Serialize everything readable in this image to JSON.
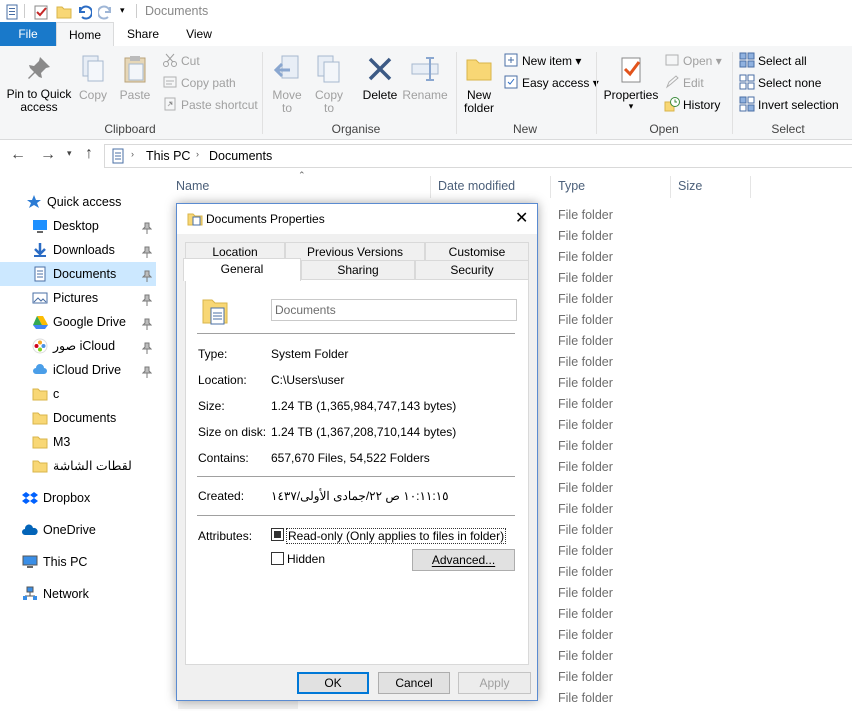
{
  "window": {
    "title": "Documents"
  },
  "qat": {
    "icons": [
      "properties-icon",
      "checkmark-icon",
      "new-folder-icon",
      "undo-icon",
      "redo-icon",
      "customize-chevron-icon"
    ]
  },
  "ribbon_tabs": [
    {
      "label": "File"
    },
    {
      "label": "Home"
    },
    {
      "label": "Share"
    },
    {
      "label": "View"
    }
  ],
  "ribbon": {
    "clipboard": {
      "pin": "Pin to Quick\naccess",
      "copy": "Copy",
      "paste": "Paste",
      "cut": "Cut",
      "copy_path": "Copy path",
      "paste_shortcut": "Paste shortcut",
      "label": "Clipboard"
    },
    "organise": {
      "move_to": "Move\nto",
      "copy_to": "Copy\nto",
      "delete": "Delete",
      "rename": "Rename",
      "label": "Organise"
    },
    "new": {
      "new_folder": "New\nfolder",
      "new_item": "New item",
      "easy_access": "Easy access",
      "label": "New"
    },
    "open": {
      "properties": "Properties",
      "open": "Open",
      "edit": "Edit",
      "history": "History",
      "label": "Open"
    },
    "select": {
      "select_all": "Select all",
      "select_none": "Select none",
      "invert": "Invert selection",
      "label": "Select"
    }
  },
  "address": {
    "crumbs": [
      "This PC",
      "Documents"
    ]
  },
  "sidebar": [
    {
      "label": "Quick access",
      "icon": "star-icon",
      "pinned": false
    },
    {
      "label": "Desktop",
      "icon": "desktop-icon",
      "pinned": true
    },
    {
      "label": "Downloads",
      "icon": "download-icon",
      "pinned": true
    },
    {
      "label": "Documents",
      "icon": "documents-icon",
      "pinned": true,
      "selected": true
    },
    {
      "label": "Pictures",
      "icon": "pictures-icon",
      "pinned": true
    },
    {
      "label": "Google Drive",
      "icon": "google-drive-icon",
      "pinned": true
    },
    {
      "label": "صور iCloud",
      "icon": "icloud-photos-icon",
      "pinned": true
    },
    {
      "label": "iCloud Drive",
      "icon": "icloud-drive-icon",
      "pinned": true
    },
    {
      "label": "c",
      "icon": "folder-icon",
      "pinned": false
    },
    {
      "label": "Documents",
      "icon": "folder-icon",
      "pinned": false
    },
    {
      "label": "M3",
      "icon": "folder-icon",
      "pinned": false
    },
    {
      "label": "لقطات الشاشة",
      "icon": "folder-icon",
      "pinned": false
    },
    {
      "label": "Dropbox",
      "icon": "dropbox-icon",
      "pinned": false
    },
    {
      "label": "OneDrive",
      "icon": "onedrive-icon",
      "pinned": false
    },
    {
      "label": "This PC",
      "icon": "this-pc-icon",
      "pinned": false
    },
    {
      "label": "Network",
      "icon": "network-icon",
      "pinned": false
    }
  ],
  "columns": [
    "Name",
    "Date modified",
    "Type",
    "Size"
  ],
  "file_rows": [
    "File folder",
    "File folder",
    "File folder",
    "File folder",
    "File folder",
    "File folder",
    "File folder",
    "File folder",
    "File folder",
    "File folder",
    "File folder",
    "File folder",
    "File folder",
    "File folder",
    "File folder",
    "File folder",
    "File folder",
    "File folder",
    "File folder",
    "File folder",
    "File folder",
    "File folder",
    "File folder",
    "File folder",
    "File folder"
  ],
  "dialog": {
    "title": "Documents Properties",
    "tabs_back": [
      "Location",
      "Previous Versions",
      "Customise"
    ],
    "tabs_front": [
      "General",
      "Sharing",
      "Security"
    ],
    "name_value": "Documents",
    "props": [
      {
        "label": "Type:",
        "value": "System Folder"
      },
      {
        "label": "Location:",
        "value": "C:\\Users\\user"
      },
      {
        "label": "Size:",
        "value": "1.24 TB (1,365,984,747,143 bytes)"
      },
      {
        "label": "Size on disk:",
        "value": "1.24 TB (1,367,208,710,144 bytes)"
      },
      {
        "label": "Contains:",
        "value": "657,670 Files, 54,522 Folders"
      }
    ],
    "created_label": "Created:",
    "created_value": "١٠:١١:١٥ ص ٢٢/جمادى الأولى/١٤٣٧",
    "attributes_label": "Attributes:",
    "readonly": "Read-only (Only applies to files in folder)",
    "hidden": "Hidden",
    "advanced": "Advanced...",
    "ok": "OK",
    "cancel": "Cancel",
    "apply": "Apply"
  }
}
